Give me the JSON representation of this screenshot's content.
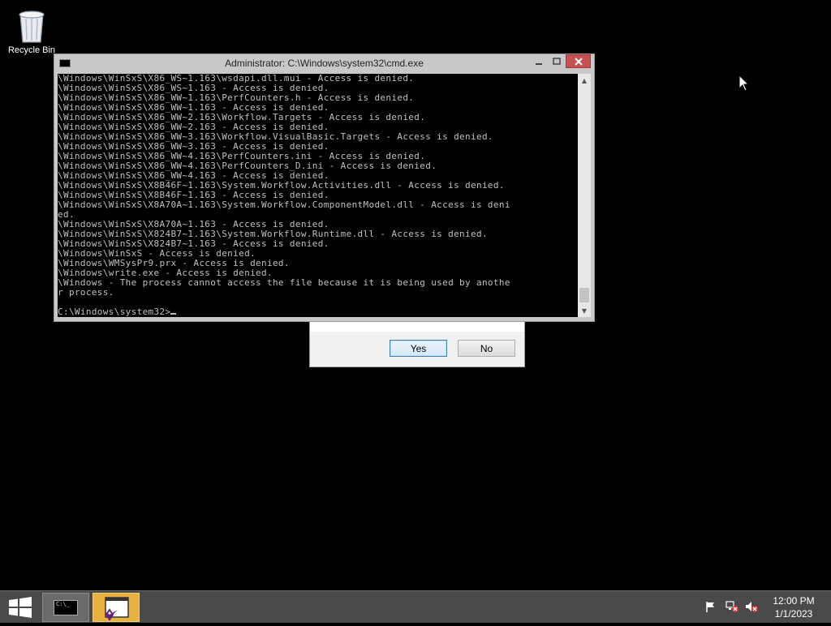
{
  "desktop": {
    "recycle_bin_label": "Recycle Bin"
  },
  "console": {
    "title": "Administrator: C:\\Windows\\system32\\cmd.exe",
    "lines": [
      "\\Windows\\WinSxS\\X86_WS~1.163\\wsdapi.dll.mui - Access is denied.",
      "\\Windows\\WinSxS\\X86_WS~1.163 - Access is denied.",
      "\\Windows\\WinSxS\\X86_WW~1.163\\PerfCounters.h - Access is denied.",
      "\\Windows\\WinSxS\\X86_WW~1.163 - Access is denied.",
      "\\Windows\\WinSxS\\X86_WW~2.163\\Workflow.Targets - Access is denied.",
      "\\Windows\\WinSxS\\X86_WW~2.163 - Access is denied.",
      "\\Windows\\WinSxS\\X86_WW~3.163\\Workflow.VisualBasic.Targets - Access is denied.",
      "\\Windows\\WinSxS\\X86_WW~3.163 - Access is denied.",
      "\\Windows\\WinSxS\\X86_WW~4.163\\PerfCounters.ini - Access is denied.",
      "\\Windows\\WinSxS\\X86_WW~4.163\\PerfCounters_D.ini - Access is denied.",
      "\\Windows\\WinSxS\\X86_WW~4.163 - Access is denied.",
      "\\Windows\\WinSxS\\X8B46F~1.163\\System.Workflow.Activities.dll - Access is denied.",
      "\\Windows\\WinSxS\\X8B46F~1.163 - Access is denied.",
      "\\Windows\\WinSxS\\X8A70A~1.163\\System.Workflow.ComponentModel.dll - Access is deni",
      "ed.",
      "\\Windows\\WinSxS\\X8A70A~1.163 - Access is denied.",
      "\\Windows\\WinSxS\\X824B7~1.163\\System.Workflow.Runtime.dll - Access is denied.",
      "\\Windows\\WinSxS\\X824B7~1.163 - Access is denied.",
      "\\Windows\\WinSxS - Access is denied.",
      "\\Windows\\WMSysPr9.prx - Access is denied.",
      "\\Windows\\write.exe - Access is denied.",
      "\\Windows - The process cannot access the file because it is being used by anothe",
      "r process.",
      "",
      "C:\\Windows\\system32>"
    ]
  },
  "dialog": {
    "yes_label": "Yes",
    "no_label": "No"
  },
  "taskbar": {
    "cmd_icon_text": "C:\\_",
    "clock_time": "12:00 PM",
    "clock_date": "1/1/2023"
  }
}
